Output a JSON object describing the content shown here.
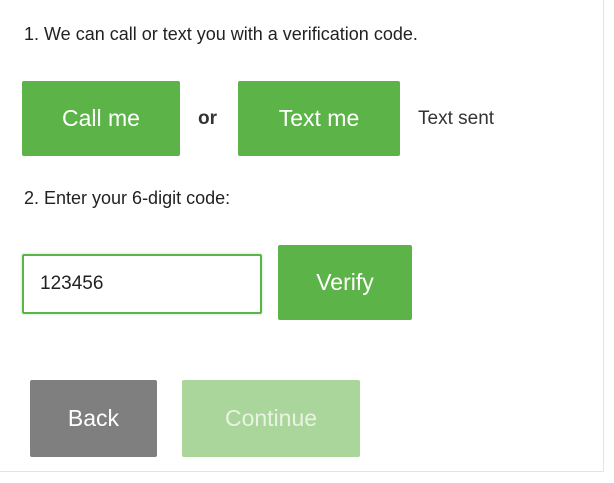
{
  "steps": {
    "step1": "1. We can call or text you with a verification code.",
    "step2": "2. Enter your 6-digit code:"
  },
  "contact": {
    "call_label": "Call me",
    "or_label": "or",
    "text_label": "Text me",
    "status": "Text sent"
  },
  "code": {
    "value": "123456",
    "verify_label": "Verify"
  },
  "nav": {
    "back_label": "Back",
    "continue_label": "Continue"
  },
  "colors": {
    "primary_green": "#5cb347",
    "disabled_green": "#aad69b",
    "back_gray": "#7f7f7f"
  }
}
